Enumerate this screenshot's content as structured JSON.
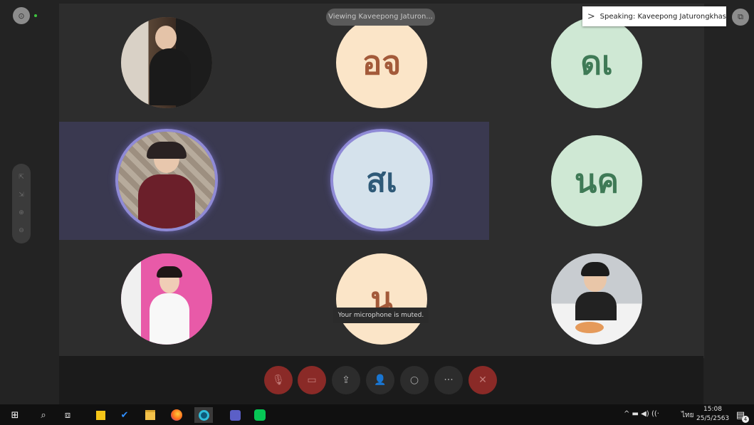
{
  "meeting": {
    "viewing_label": "Viewing Kaveepong Jaturon...",
    "speaking_label": "Speaking: Kaveepong Jaturongkhas...",
    "mute_toast": "Your microphone is muted."
  },
  "participants": [
    {
      "initials": "",
      "bg": "#7a6a5c",
      "kind": "photo-girl-window"
    },
    {
      "initials": "อจ",
      "bg": "#fbe5c8",
      "fg": "#a35a3a"
    },
    {
      "initials": "ดเ",
      "bg": "#cfe8d4",
      "fg": "#3f7a56"
    },
    {
      "initials": "",
      "bg": "#8a7a6a",
      "kind": "photo-girl-stone"
    },
    {
      "initials": "สเ",
      "bg": "#d5e2ec",
      "fg": "#2f5a78"
    },
    {
      "initials": "นค",
      "bg": "#cfe8d4",
      "fg": "#3f7a56"
    },
    {
      "initials": "",
      "bg": "#e85aa8",
      "kind": "photo-girl-pink"
    },
    {
      "initials": "น",
      "bg": "#fbe5c8",
      "fg": "#a35a3a"
    },
    {
      "initials": "",
      "bg": "#b0b4b8",
      "kind": "photo-girl-cafe"
    }
  ],
  "left_toolbar": [
    "⇱",
    "⇲",
    "⊕",
    "⊖"
  ],
  "controls": [
    {
      "name": "mute-mic",
      "icon": "🎙"
    },
    {
      "name": "camera",
      "icon": "▭"
    },
    {
      "name": "share-screen",
      "icon": "⇪"
    },
    {
      "name": "participants",
      "icon": "👤"
    },
    {
      "name": "chat",
      "icon": "○"
    },
    {
      "name": "more-options",
      "icon": "···"
    },
    {
      "name": "hang-up",
      "icon": "✕"
    }
  ],
  "taskbar": {
    "language": "ไทย",
    "time": "15:08",
    "date": "25/5/2563",
    "notification_count": "4",
    "tray_icons": "^  ▬  ◀)  ((·"
  }
}
